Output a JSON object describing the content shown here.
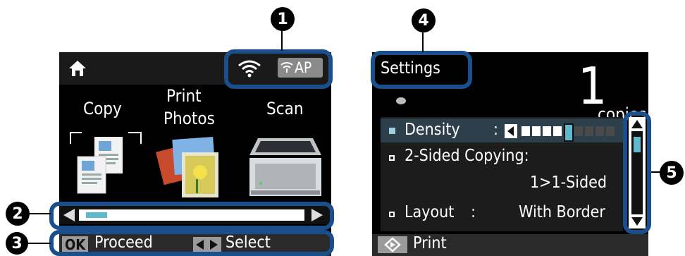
{
  "callout_numbers": [
    "1",
    "2",
    "3",
    "4",
    "5"
  ],
  "left_screen": {
    "home_icon": "home-icon",
    "wifi_icon": "wifi-icon",
    "ap_badge": "AP",
    "menu": [
      {
        "label": "Copy",
        "icon": "copy-icon"
      },
      {
        "label_line1": "Print",
        "label_line2": "Photos",
        "icon": "photo-icon"
      },
      {
        "label": "Scan",
        "icon": "scanner-icon"
      }
    ],
    "scroll_position_fraction": 0.05,
    "footer": {
      "ok_key": "OK",
      "proceed": "Proceed",
      "select": "Select"
    }
  },
  "right_screen": {
    "title": "Settings",
    "copies_value": "1",
    "copies_label": "copies",
    "items": [
      {
        "label": "Density",
        "sep": ":"
      },
      {
        "label": "2-Sided Copying:",
        "value": "1>1-Sided"
      },
      {
        "label": "Layout",
        "sep": ":",
        "value": "With Border"
      }
    ],
    "density_level": 4,
    "density_levels": 9,
    "footer_print": "Print"
  },
  "colors": {
    "callout": "#1b4f8c",
    "highlight": "#5fb8cc",
    "selected_row": "#2e3f4c"
  }
}
